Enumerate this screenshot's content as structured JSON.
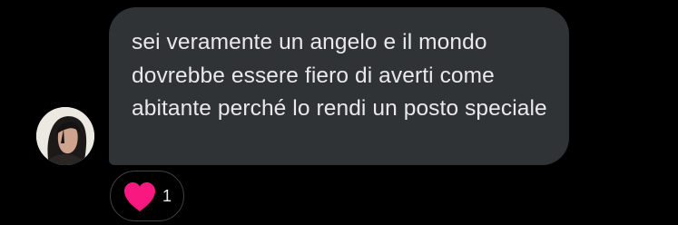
{
  "message": {
    "text": "sei veramente un angelo e il mondo dovrebbe essere fiero di averti come abitante perché lo rendi un posto speciale"
  },
  "reaction": {
    "icon": "heart-icon",
    "count": "1",
    "color": "#f91880"
  },
  "colors": {
    "background": "#000000",
    "bubble": "#2f3336",
    "text": "#e7e9ea"
  }
}
